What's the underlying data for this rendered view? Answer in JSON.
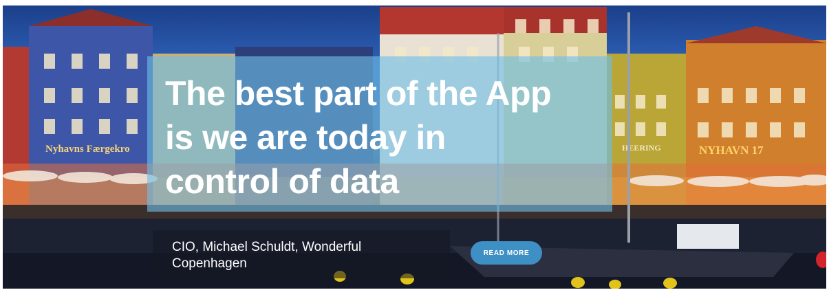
{
  "hero": {
    "headline_lines": [
      "The best part of the App",
      "is we are today in",
      "control of data"
    ],
    "caption_lines": [
      "CIO, Michael Schuldt, Wonderful",
      "Copenhagen"
    ],
    "read_more_label": "READ MORE",
    "sign_left": "Nyhavns Færgekro",
    "sign_middle": "HEERING",
    "sign_right": "NYHAVN 17"
  },
  "colors": {
    "headline_panel": "#6ebee6",
    "button": "#3d8fc4",
    "sky": "#2f62b8"
  }
}
